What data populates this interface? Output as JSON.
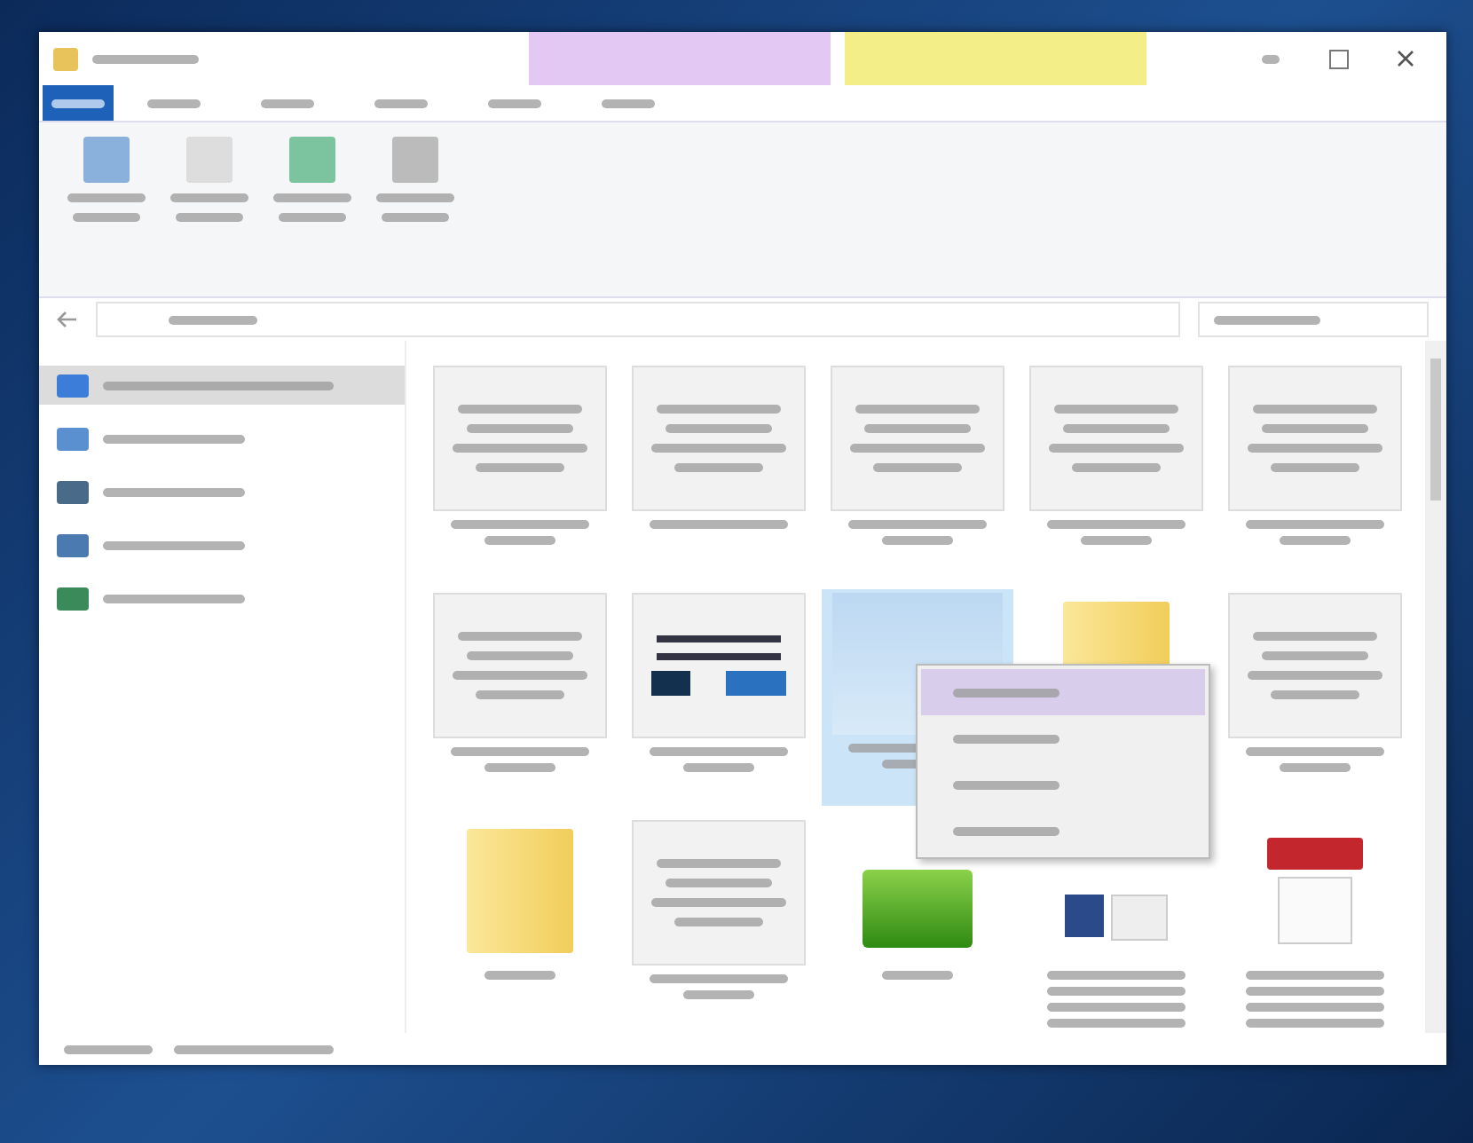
{
  "window": {
    "context_bands": [
      {
        "color": "#e4c8f4"
      },
      {
        "color": "#f4ee88"
      }
    ]
  },
  "ribbon_tabs": [
    {
      "selected": true
    },
    {
      "selected": false
    },
    {
      "selected": false
    },
    {
      "selected": false
    },
    {
      "selected": false
    },
    {
      "selected": false
    }
  ],
  "ribbon_buttons": [
    {
      "kind": "pin"
    },
    {
      "kind": "clipboard"
    },
    {
      "kind": "move"
    },
    {
      "kind": "copy"
    }
  ],
  "sidebar": {
    "items": [
      {
        "kind": "quick-access",
        "selected": true
      },
      {
        "kind": "cloud",
        "selected": false
      },
      {
        "kind": "computer",
        "selected": false
      },
      {
        "kind": "network",
        "selected": false
      },
      {
        "kind": "homegroup",
        "selected": false
      }
    ]
  },
  "files": [
    {
      "kind": "document",
      "caption_lines": [
        {
          "kind": "long"
        },
        {
          "kind": "short"
        }
      ],
      "selected": false
    },
    {
      "kind": "document",
      "caption_lines": [
        {
          "kind": "long"
        }
      ],
      "selected": false
    },
    {
      "kind": "document",
      "caption_lines": [
        {
          "kind": "long"
        },
        {
          "kind": "short"
        }
      ],
      "selected": false
    },
    {
      "kind": "document",
      "caption_lines": [
        {
          "kind": "long"
        },
        {
          "kind": "short"
        }
      ],
      "selected": false
    },
    {
      "kind": "document",
      "caption_lines": [
        {
          "kind": "long"
        },
        {
          "kind": "short"
        }
      ],
      "selected": false
    },
    {
      "kind": "document",
      "caption_lines": [
        {
          "kind": "long"
        },
        {
          "kind": "short"
        }
      ],
      "selected": false
    },
    {
      "kind": "chart",
      "caption_lines": [
        {
          "kind": "long"
        },
        {
          "kind": "short"
        }
      ],
      "selected": false
    },
    {
      "kind": "image",
      "caption_lines": [
        {
          "kind": "long"
        },
        {
          "kind": "short"
        }
      ],
      "selected": true
    },
    {
      "kind": "folder",
      "selected": false
    },
    {
      "kind": "document",
      "caption_lines": [
        {
          "kind": "long"
        },
        {
          "kind": "short"
        }
      ],
      "selected": false
    },
    {
      "kind": "folder",
      "caption_lines": [
        {
          "kind": "short"
        }
      ],
      "selected": false
    },
    {
      "kind": "document",
      "caption_lines": [
        {
          "kind": "long"
        },
        {
          "kind": "short"
        }
      ],
      "selected": false
    },
    {
      "kind": "archive",
      "caption_lines": [
        {
          "kind": "short"
        }
      ],
      "selected": false
    },
    {
      "kind": "word",
      "caption_lines": [
        {
          "kind": "long"
        },
        {
          "kind": "long"
        },
        {
          "kind": "long"
        },
        {
          "kind": "long"
        }
      ],
      "selected": false
    },
    {
      "kind": "pdf",
      "caption_lines": [
        {
          "kind": "long"
        },
        {
          "kind": "long"
        },
        {
          "kind": "long"
        },
        {
          "kind": "long"
        }
      ],
      "selected": false
    }
  ],
  "context_menu": [
    {
      "selected": true
    },
    {
      "selected": false
    },
    {
      "selected": false
    },
    {
      "selected": false
    }
  ]
}
